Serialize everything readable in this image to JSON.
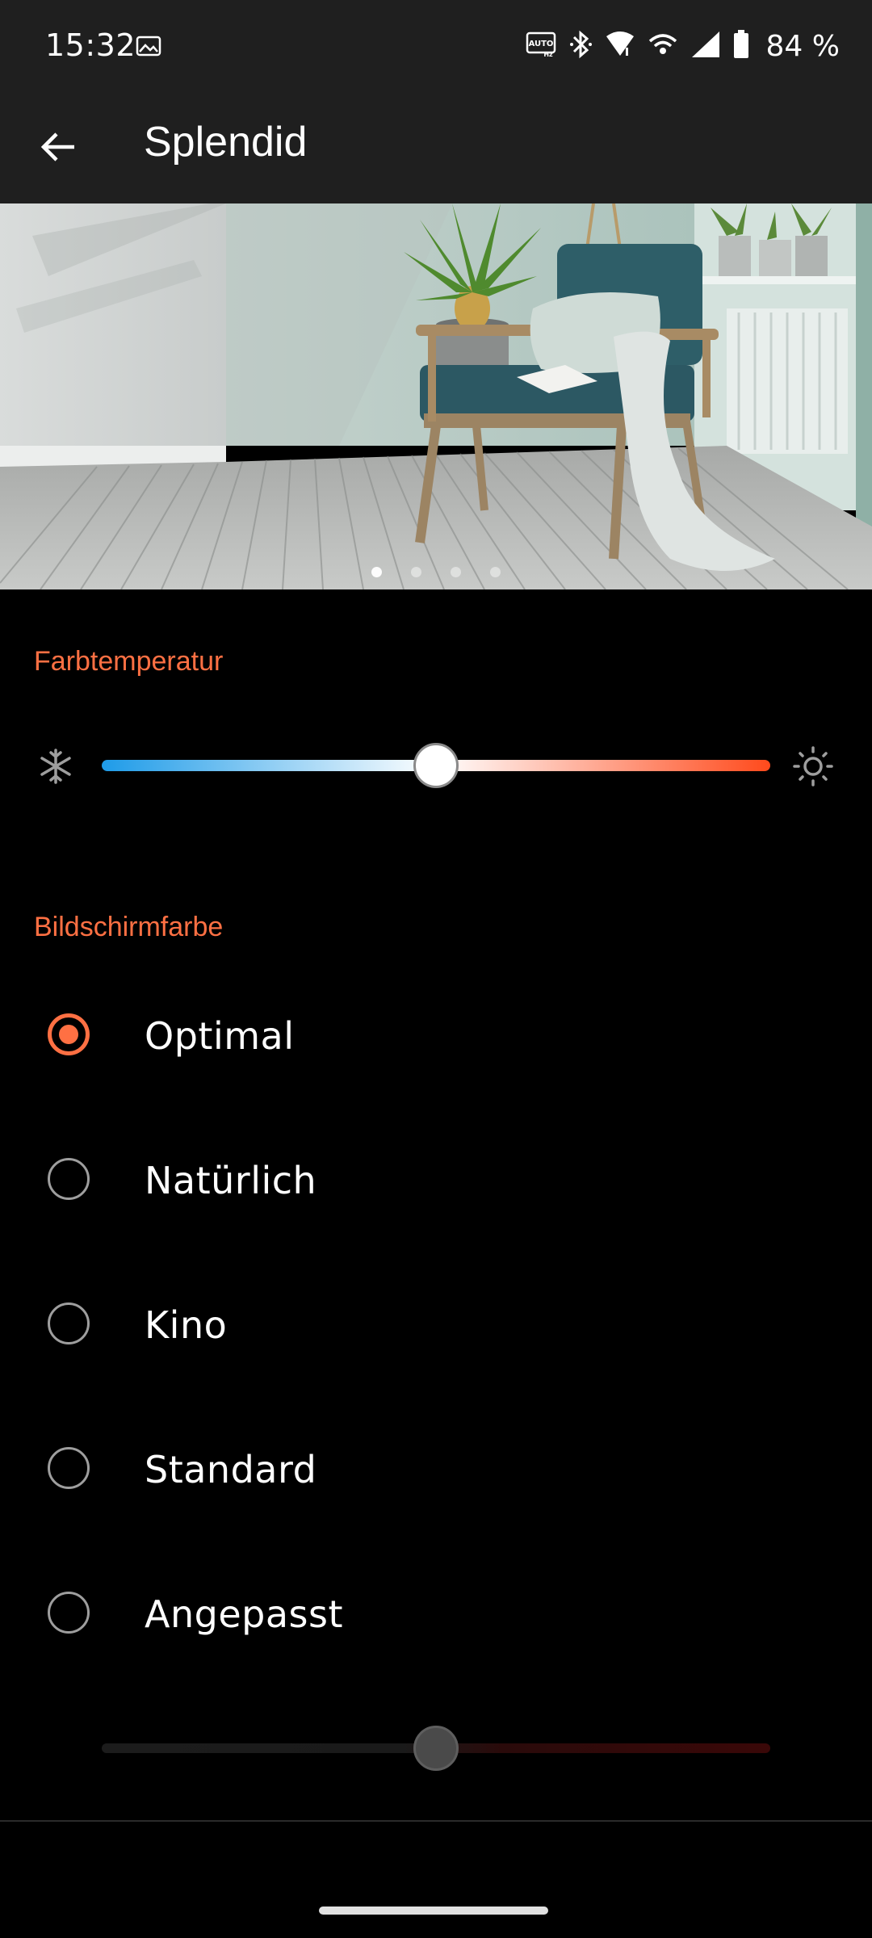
{
  "status_bar": {
    "time": "15:32",
    "battery": "84 %",
    "icons": [
      "image-icon",
      "auto-hz-icon",
      "bluetooth-icon",
      "wifi-icon",
      "hotspot-icon",
      "signal-icon",
      "battery-icon"
    ]
  },
  "app_bar": {
    "title": "Splendid",
    "back_icon": "arrow-back-icon"
  },
  "carousel": {
    "page_count": 4,
    "active_index": 0
  },
  "color_temperature": {
    "label": "Farbtemperatur",
    "value_fraction": 0.5,
    "left_icon": "snowflake-icon",
    "right_icon": "sun-icon",
    "gradient_colors": [
      "#1e9be8",
      "#ffffff",
      "#ff4a1c"
    ]
  },
  "screen_color": {
    "label": "Bildschirmfarbe",
    "options": [
      {
        "label": "Optimal",
        "selected": true
      },
      {
        "label": "Natürlich",
        "selected": false
      },
      {
        "label": "Kino",
        "selected": false
      },
      {
        "label": "Standard",
        "selected": false
      },
      {
        "label": "Angepasst",
        "selected": false
      }
    ],
    "custom_slider_fraction": 0.5,
    "custom_slider_enabled": false
  },
  "colors": {
    "accent": "#ff7043",
    "background": "#000000",
    "bar_background": "#1f1f1f"
  }
}
